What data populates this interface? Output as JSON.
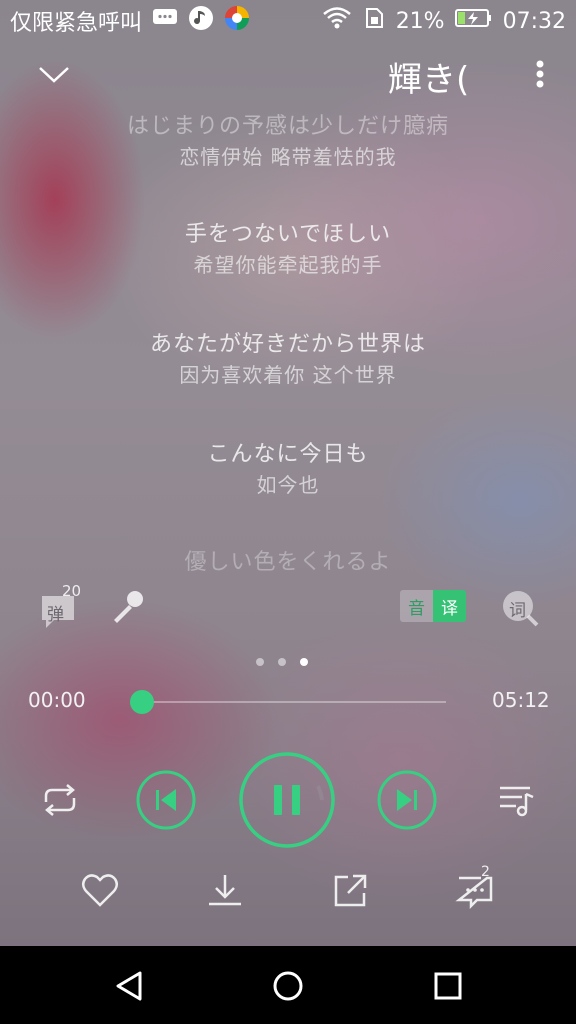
{
  "status_bar": {
    "carrier": "仅限紧急呼叫",
    "battery": "21%",
    "time": "07:32",
    "icons": [
      "chat-bubble-icon",
      "music-app-icon",
      "colorful-app-icon",
      "wifi-icon",
      "sim-icon",
      "battery-charging-icon"
    ]
  },
  "header": {
    "title": "輝き(",
    "collapse_icon": "chevron-down-icon",
    "more_icon": "more-vertical-icon"
  },
  "lyrics": [
    {
      "jp": "はじまりの予感は少しだけ臆病",
      "cn": "恋情伊始 略带羞怯的我"
    },
    {
      "jp": "手をつないでほしい",
      "cn": "希望你能牵起我的手"
    },
    {
      "jp": "あなたが好きだから世界は",
      "cn": "因为喜欢着你 这个世界"
    },
    {
      "jp": "こんなに今日も",
      "cn": "如今也"
    },
    {
      "jp": "優しい色をくれるよ",
      "cn": ""
    }
  ],
  "tools": {
    "danmu_label": "弹",
    "danmu_count": "20",
    "translate_options": [
      "音",
      "译"
    ],
    "translate_selected": "译",
    "lyric_search_label": "词"
  },
  "pager": {
    "count": 3,
    "active_index": 2
  },
  "playback": {
    "current_time": "00:00",
    "total_time": "05:12",
    "progress": 0
  },
  "actions": {
    "comment_count": "2"
  },
  "colors": {
    "accent": "#37d082"
  }
}
